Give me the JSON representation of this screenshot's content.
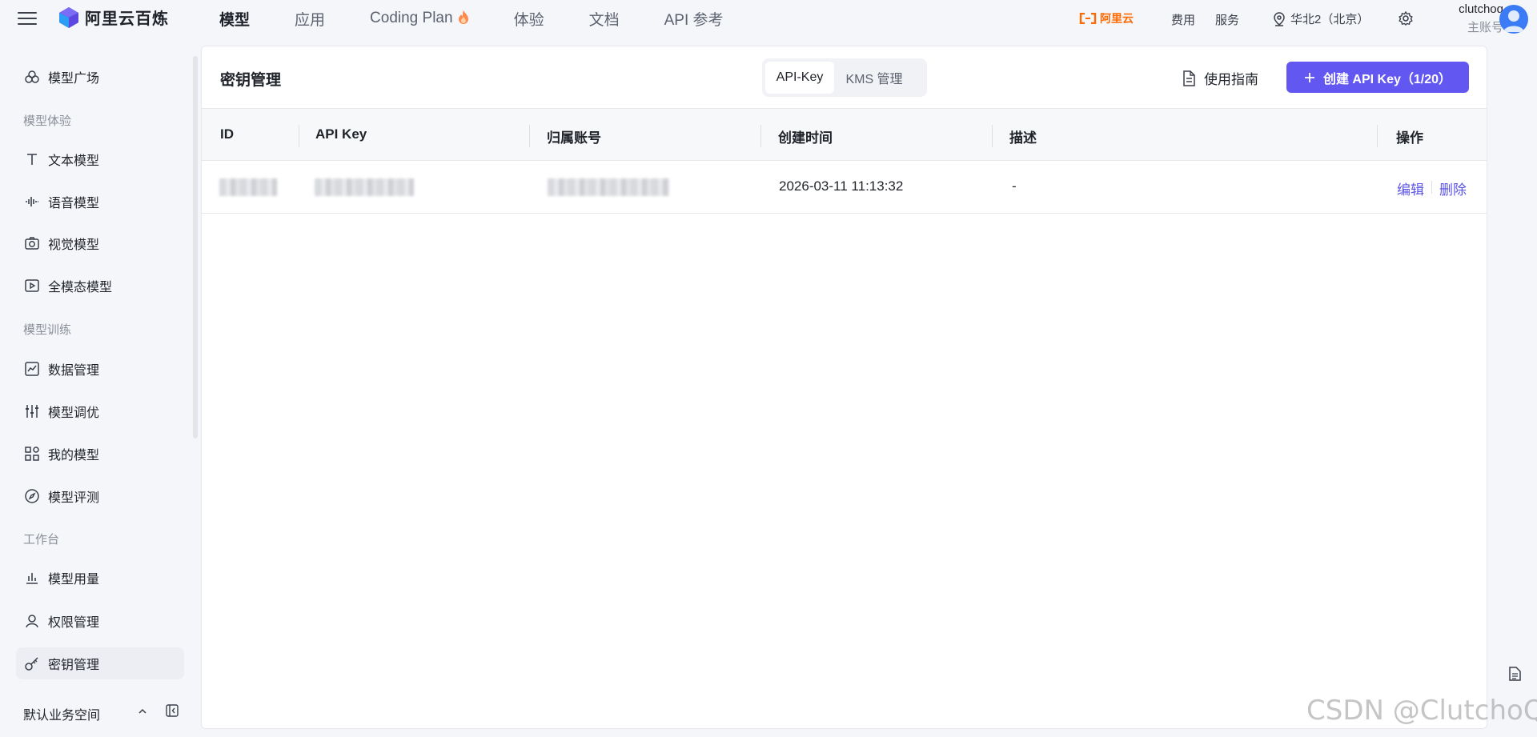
{
  "app": {
    "brand_name": "阿里云百炼",
    "brand_color": "#6257f0"
  },
  "topnav": {
    "items": [
      {
        "label": "模型",
        "active": true
      },
      {
        "label": "应用",
        "active": false
      },
      {
        "label": "Coding Plan",
        "active": false,
        "icon": "flame-icon"
      },
      {
        "label": "体验",
        "active": false
      },
      {
        "label": "文档",
        "active": false
      },
      {
        "label": "API 参考",
        "active": false
      }
    ]
  },
  "topright": {
    "aliyun_label": "阿里云",
    "fees_label": "费用",
    "service_label": "服务",
    "region_label": "华北2（北京）",
    "user_name": "clutchoq",
    "user_role": "主账号"
  },
  "sidebar": {
    "item_model_square": "模型广场",
    "group_experience": "模型体验",
    "item_text_model": "文本模型",
    "item_voice_model": "语音模型",
    "item_vision_model": "视觉模型",
    "item_omni_model": "全模态模型",
    "group_training": "模型训练",
    "item_data_mgmt": "数据管理",
    "item_finetune": "模型调优",
    "item_my_models": "我的模型",
    "item_evaluation": "模型评测",
    "group_workbench": "工作台",
    "item_usage": "模型用量",
    "item_permissions": "权限管理",
    "item_key_mgmt": "密钥管理",
    "workspace_label": "默认业务空间"
  },
  "page": {
    "title": "密钥管理",
    "tabs": [
      {
        "label": "API-Key",
        "active": true
      },
      {
        "label": "KMS 管理",
        "active": false
      }
    ],
    "guide_label": "使用指南",
    "create_label": "创建 API Key（1/20）"
  },
  "table": {
    "columns": [
      "ID",
      "API Key",
      "归属账号",
      "创建时间",
      "描述",
      "操作"
    ],
    "rows": [
      {
        "created_at": "2026-03-11 11:13:32",
        "description": "-",
        "action_edit": "编辑",
        "action_delete": "删除"
      }
    ]
  },
  "watermark": "CSDN @ClutchoQ"
}
